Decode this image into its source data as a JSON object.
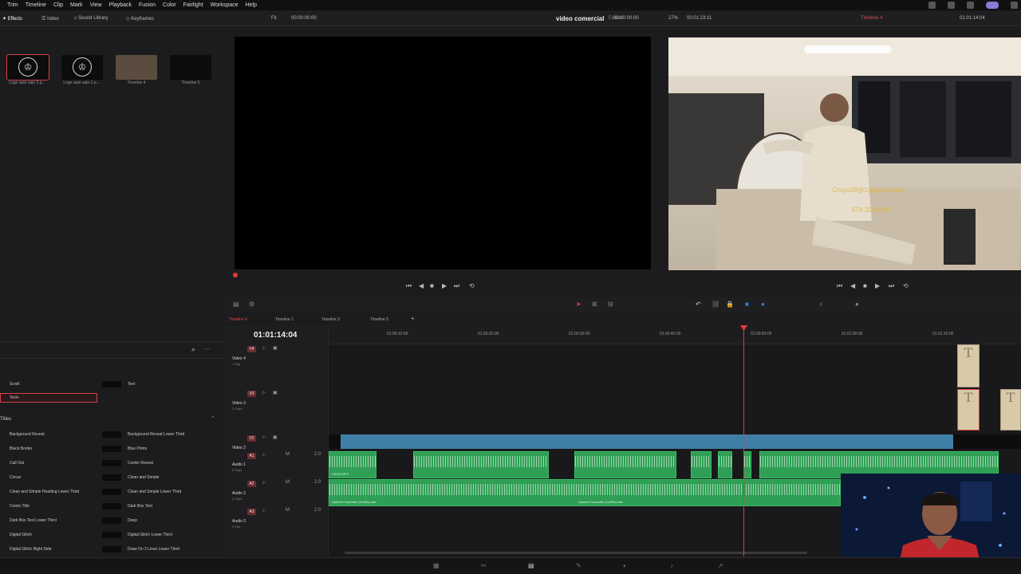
{
  "menubar": {
    "items": [
      "Trim",
      "Timeline",
      "Clip",
      "Mark",
      "View",
      "Playback",
      "Fusion",
      "Color",
      "Fairlight",
      "Workspace",
      "Help"
    ]
  },
  "toolbar": {
    "effects": "Effects",
    "index": "Index",
    "sound_library": "Sound Library",
    "keyframes": "Keyframes",
    "fit": "Fit",
    "source_tc": "00:00:00:00",
    "project_title": "video comercial",
    "project_status": "Edited",
    "program_tc_left": "00:00:00:00",
    "zoom": "27%",
    "duration": "00:01:23:11",
    "timeline_name": "Timeline 4",
    "program_tc": "01:01:14:04"
  },
  "media_pool": {
    "items": [
      {
        "label": "Logo auto sale 3.p..."
      },
      {
        "label": "Logo auto sale 2.p..."
      },
      {
        "label": "Timeline 4"
      },
      {
        "label": "Timeline 5"
      }
    ]
  },
  "viewer": {
    "email": "Chuyo29@1@gmail.com",
    "phone": "574-206-6899"
  },
  "timeline_tabs": [
    "Timeline 4",
    "Timeline 1",
    "Timeline 3",
    "Timeline 5"
  ],
  "timeline": {
    "timecode": "01:01:14:04",
    "ruler": [
      "01:00:10:00",
      "01:00:20:00",
      "01:00:30:00",
      "01:00:40:00",
      "01:00:50:00",
      "01:01:00:00",
      "01:01:10:00"
    ],
    "tracks": [
      {
        "badge": "V4",
        "name": "Video 4",
        "sub": "1 Clip"
      },
      {
        "badge": "V3",
        "name": "Video 3",
        "sub": "2 Clips"
      },
      {
        "badge": "V2",
        "name": "Video 2",
        "sub": ""
      },
      {
        "badge": "A1",
        "name": "Audio 1",
        "sub": "8 Clips",
        "level": "2.0"
      },
      {
        "badge": "A2",
        "name": "Audio 2",
        "sub": "2 Clips",
        "level": "2.0"
      },
      {
        "badge": "A3",
        "name": "Audio 3",
        "sub": "0 Clip",
        "level": "2.0"
      }
    ],
    "audio1_clip_label": "C6332.MP4",
    "audio2_clip_label": "Upbeat Corporate (1m30s).wav",
    "audio2_clip_label2": "Upbeat Corporate (1m30s).wav"
  },
  "effects": {
    "scroll": "Scroll",
    "text": "Text",
    "textplus": "Text+",
    "titles_header": "Titles",
    "titles": [
      {
        "left": "Background Reveal",
        "right": "Background Reveal Lower Third"
      },
      {
        "left": "Black Border",
        "right": "Blue Prints"
      },
      {
        "left": "Call Out",
        "right": "Center Reveal"
      },
      {
        "left": "Circus",
        "right": "Clean and Simple"
      },
      {
        "left": "Clean and Simple Heading Lower Third",
        "right": "Clean and Simple Lower Third"
      },
      {
        "left": "Comic Title",
        "right": "Dark Box Text"
      },
      {
        "left": "Dark Box Text Lower Third",
        "right": "Deep"
      },
      {
        "left": "Digital Glitch",
        "right": "Digital Glitch Lower Third"
      },
      {
        "left": "Digital Glitch Right Side",
        "right": "Draw On 2 Lines Lower Third"
      }
    ]
  },
  "colors": {
    "accent_red": "#e23b3b",
    "audio_clip": "#2e9f54",
    "video_bar": "#3f7fa6"
  }
}
